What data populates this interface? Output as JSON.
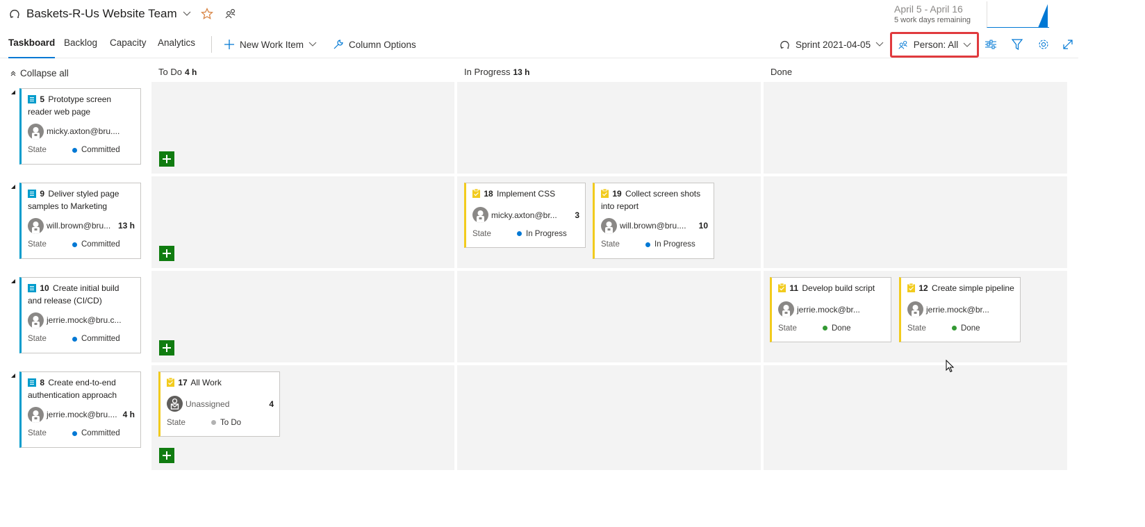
{
  "header": {
    "team_name": "Baskets-R-Us Website Team",
    "sprint_dates": "April 5 - April 16",
    "days_remaining": "5 work days remaining"
  },
  "nav": {
    "tabs": [
      {
        "label": "Taskboard",
        "active": true
      },
      {
        "label": "Backlog",
        "active": false
      },
      {
        "label": "Capacity",
        "active": false
      },
      {
        "label": "Analytics",
        "active": false
      }
    ],
    "new_work_item": "New Work Item",
    "column_options": "Column Options",
    "sprint_selector": "Sprint 2021-04-05",
    "person_filter": "Person: All"
  },
  "board": {
    "collapse_all": "Collapse all",
    "columns": [
      {
        "name": "To Do",
        "hours": "4 h"
      },
      {
        "name": "In Progress",
        "hours": "13 h"
      },
      {
        "name": "Done",
        "hours": ""
      }
    ],
    "state_label": "State",
    "colors": {
      "committed": "#0078d4",
      "in_progress": "#0078d4",
      "done": "#339933",
      "todo": "#b2b2b2",
      "backlog_item_bar": "#009ccc",
      "task_bar": "#f2cb1d",
      "add_button": "#107c10",
      "highlight": "#e03a3e"
    },
    "rows": [
      {
        "parent": {
          "id": "5",
          "title": "Prototype screen reader web page",
          "assignee": "micky.axton@bru....",
          "hours": "",
          "state": "Committed"
        },
        "todo": [],
        "in_progress": [],
        "done": []
      },
      {
        "parent": {
          "id": "9",
          "title": "Deliver styled page samples to Marketing",
          "assignee": "will.brown@bru...",
          "hours": "13 h",
          "state": "Committed"
        },
        "todo": [],
        "in_progress": [
          {
            "id": "18",
            "title": "Implement CSS",
            "assignee": "micky.axton@br...",
            "hours": "3",
            "state": "In Progress"
          },
          {
            "id": "19",
            "title": "Collect screen shots into report",
            "assignee": "will.brown@bru....",
            "hours": "10",
            "state": "In Progress"
          }
        ],
        "done": []
      },
      {
        "parent": {
          "id": "10",
          "title": "Create initial build and release (CI/CD)",
          "assignee": "jerrie.mock@bru.c...",
          "hours": "",
          "state": "Committed"
        },
        "todo": [],
        "in_progress": [],
        "done": [
          {
            "id": "11",
            "title": "Develop build script",
            "assignee": "jerrie.mock@br...",
            "hours": "",
            "state": "Done"
          },
          {
            "id": "12",
            "title": "Create simple pipeline",
            "assignee": "jerrie.mock@br...",
            "hours": "",
            "state": "Done"
          }
        ]
      },
      {
        "parent": {
          "id": "8",
          "title": "Create end-to-end authentication approach",
          "assignee": "jerrie.mock@bru....",
          "hours": "4 h",
          "state": "Committed"
        },
        "todo": [
          {
            "id": "17",
            "title": "All Work",
            "assignee": "Unassigned",
            "hours": "4",
            "state": "To Do"
          }
        ],
        "in_progress": [],
        "done": []
      }
    ]
  }
}
